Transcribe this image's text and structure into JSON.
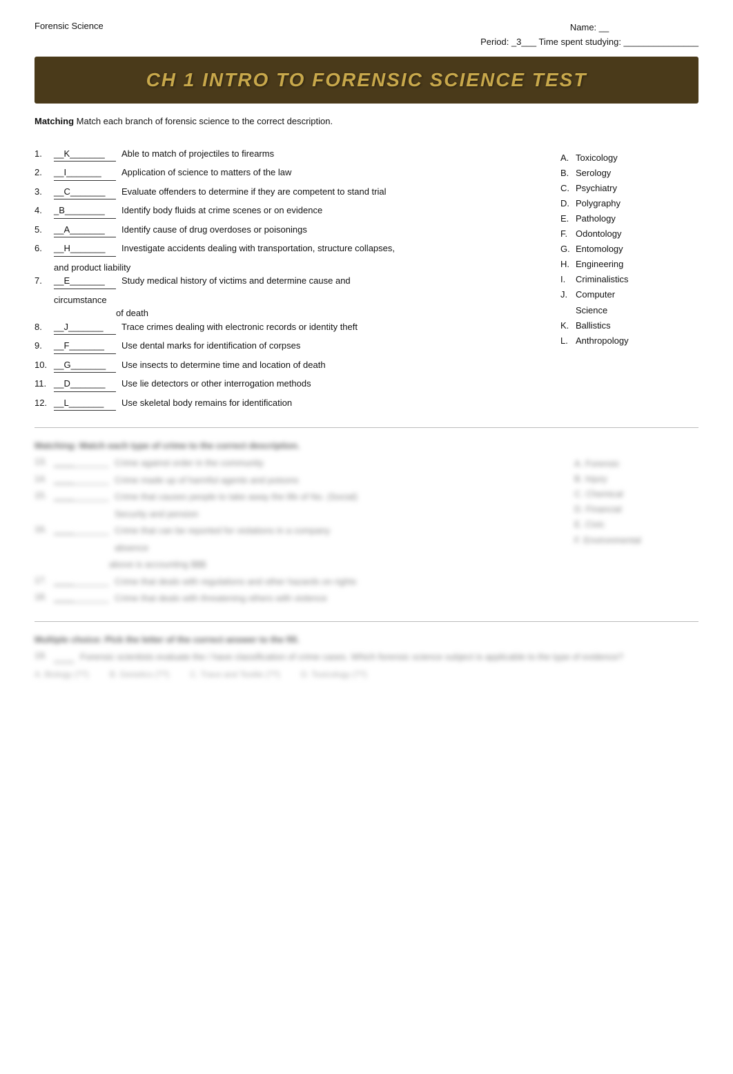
{
  "header": {
    "subject": "Forensic Science",
    "name_label": "Name: __",
    "period_label": "Period:  _3___  Time spent studying: _______________"
  },
  "banner": {
    "text": "CH 1 INTRO TO FORENSIC SCIENCE TEST"
  },
  "section1": {
    "instruction": "Matching",
    "instruction_rest": " Match each branch of forensic science to the correct description.",
    "questions": [
      {
        "num": "1.",
        "blank": "__K_______",
        "text": "Able to match of projectiles to firearms"
      },
      {
        "num": "2.",
        "blank": "__I_______",
        "text": "Application of science to matters of the law"
      },
      {
        "num": "3.",
        "blank": "__C_______",
        "text": "Evaluate offenders to determine if they are competent to stand trial"
      },
      {
        "num": "4.",
        "blank": "_B________",
        "text": "Identify body fluids at crime scenes or on evidence"
      },
      {
        "num": "5.",
        "blank": "__A_______",
        "text": "Identify cause of drug overdoses or poisonings"
      },
      {
        "num": "6.",
        "blank": "__H_______",
        "text": "Investigate accidents dealing with transportation, structure collapses,",
        "sub": "and product liability"
      },
      {
        "num": "7.",
        "blank": "__E_______",
        "text": "Study medical history of victims and determine cause and",
        "sub2": "circumstance",
        "sub3": "of death"
      },
      {
        "num": "8.",
        "blank": "__J_______",
        "text": "Trace crimes dealing with electronic records or identity theft"
      },
      {
        "num": "9.",
        "blank": "__F_______",
        "text": "Use dental marks for identification of corpses"
      },
      {
        "num": "10.",
        "blank": "__G_______",
        "text": "Use insects to determine time and location of death"
      },
      {
        "num": "11.",
        "blank": "__D_______",
        "text": "Use lie detectors or other interrogation methods"
      },
      {
        "num": "12.",
        "blank": "__L_______",
        "text": "Use skeletal body remains for identification"
      }
    ],
    "answers": [
      {
        "letter": "A.",
        "text": "Toxicology"
      },
      {
        "letter": "B.",
        "text": "Serology"
      },
      {
        "letter": "C.",
        "text": "Psychiatry"
      },
      {
        "letter": "D.",
        "text": "Polygraphy"
      },
      {
        "letter": "E.",
        "text": "Pathology"
      },
      {
        "letter": "F.",
        "text": "Odontology"
      },
      {
        "letter": "G.",
        "text": "Entomology"
      },
      {
        "letter": "H.",
        "text": "Engineering"
      },
      {
        "letter": "I.",
        "text": "Criminalistics"
      },
      {
        "letter": "J.",
        "text": "Computer Science"
      },
      {
        "letter": "K.",
        "text": "Ballistics"
      },
      {
        "letter": "L.",
        "text": "Anthropology"
      }
    ]
  },
  "blurred_section2": {
    "title": "Matching: Match each type of crime to the correct description.",
    "questions": [
      {
        "num": "13.",
        "blank": "___",
        "text": "Crime against order in the community"
      },
      {
        "num": "14.",
        "blank": "___",
        "text": "Crime made up of harmful agents and poisons"
      },
      {
        "num": "15.",
        "blank": "___",
        "text": "Crime that causes people to take away the life of No. (Social)",
        "sub": "Security and pension"
      },
      {
        "num": "16.",
        "blank": "___",
        "text": "Crime that can be reported for violations in a company",
        "sub": "absence"
      },
      {
        "num": "",
        "blank": "",
        "text": "above is accounting $$$"
      },
      {
        "num": "17.",
        "blank": "___",
        "text": "Crime that deals with regulations and other hazards on rights"
      },
      {
        "num": "18.",
        "blank": "___",
        "text": "Crime that deals with threatening others with violence"
      }
    ],
    "answers": [
      {
        "letter": "A.",
        "text": "Forensic"
      },
      {
        "letter": "B.",
        "text": "Injury"
      },
      {
        "letter": "C.",
        "text": "Chemical"
      },
      {
        "letter": "D.",
        "text": "Financial"
      },
      {
        "letter": "E.",
        "text": "Civic"
      },
      {
        "letter": "F.",
        "text": "Environmental"
      }
    ]
  },
  "blurred_section3": {
    "title": "Multiple choice: Pick the letter of the correct answer to the fill.",
    "questions": [
      {
        "num": "19.",
        "blank": "___",
        "text": "Forensic scientists evaluate the / have classification of crime cases. Which forensic science subject is applicable to the type of evidence?",
        "choices": [
          "A. Biology (??)",
          "B. Genetics (??)",
          "C. Trace and Textile (??)",
          "D. Toxicology (??)"
        ]
      }
    ]
  }
}
